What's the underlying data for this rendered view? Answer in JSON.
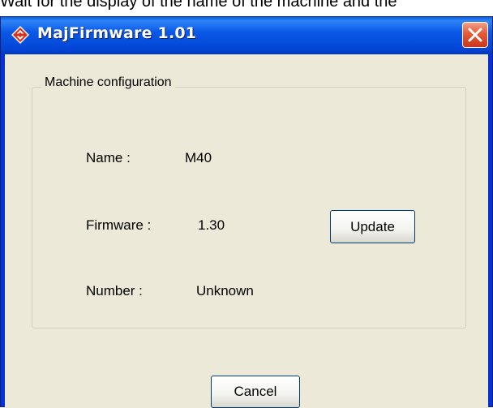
{
  "background_caption": "Wait for the display of the name of the machine and the",
  "window": {
    "title": "MajFirmware 1.01",
    "colors": {
      "titlebar": "#0a59e6",
      "client": "#ece9d8",
      "close": "#e55a36"
    }
  },
  "group": {
    "title": "Machine configuration",
    "fields": {
      "name": {
        "label": "Name :",
        "value": "M40"
      },
      "firmware": {
        "label": "Firmware :",
        "value": "1.30"
      },
      "number": {
        "label": "Number :",
        "value": "Unknown"
      }
    }
  },
  "buttons": {
    "update": "Update",
    "cancel": "Cancel"
  },
  "icons": {
    "app": "red-diamond-icon",
    "close": "close-x-icon"
  }
}
